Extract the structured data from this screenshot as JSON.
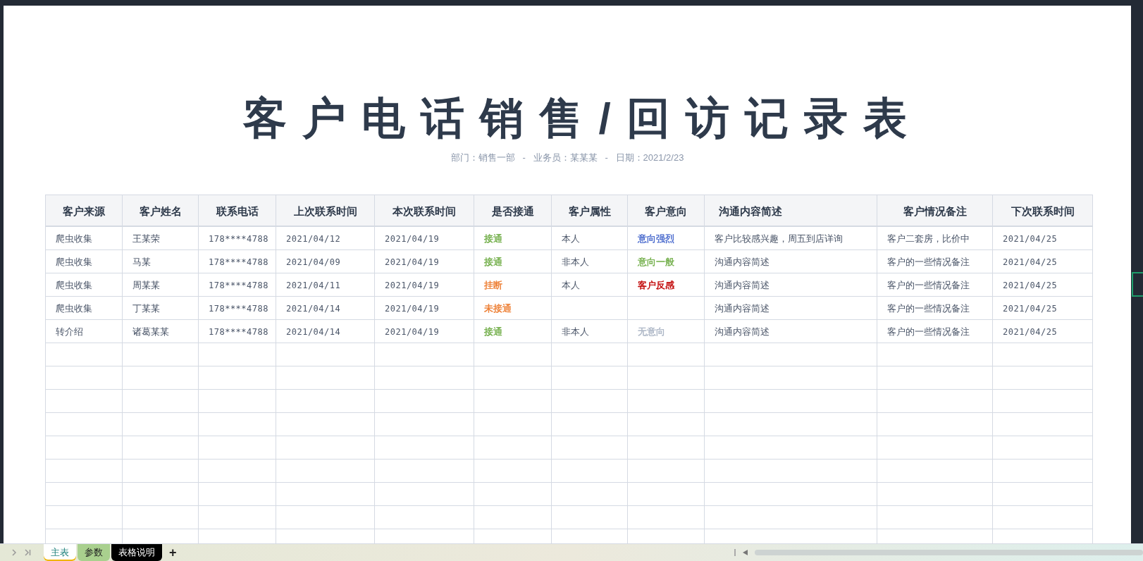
{
  "title": "客户电话销售/回访记录表",
  "subtitle": "部门：销售一部   -   业务员：某某某   -   日期：2021/2/23",
  "table": {
    "columns": [
      "客户来源",
      "客户姓名",
      "联系电话",
      "上次联系时间",
      "本次联系时间",
      "是否接通",
      "客户属性",
      "客户意向",
      "沟通内容简述",
      "客户情况备注",
      "下次联系时间"
    ],
    "rows": [
      {
        "source": "爬虫收集",
        "name": "王某荣",
        "phone": "178****4788",
        "last_contact": "2021/04/12",
        "this_contact": "2021/04/19",
        "connected": {
          "text": "接通",
          "color": "#70ad47"
        },
        "attribute": "本人",
        "intent": {
          "text": "意向强烈",
          "color": "#4466cc"
        },
        "summary": "客户比较感兴趣，周五到店详询",
        "remarks": "客户二套房，比价中",
        "next_contact": "2021/04/25"
      },
      {
        "source": "爬虫收集",
        "name": "马某",
        "phone": "178****4788",
        "last_contact": "2021/04/09",
        "this_contact": "2021/04/19",
        "connected": {
          "text": "接通",
          "color": "#70ad47"
        },
        "attribute": "非本人",
        "intent": {
          "text": "意向一般",
          "color": "#70ad47"
        },
        "summary": "沟通内容简述",
        "remarks": "客户的一些情况备注",
        "next_contact": "2021/04/25"
      },
      {
        "source": "爬虫收集",
        "name": "周某某",
        "phone": "178****4788",
        "last_contact": "2021/04/11",
        "this_contact": "2021/04/19",
        "connected": {
          "text": "挂断",
          "color": "#ed7d31"
        },
        "attribute": "本人",
        "intent": {
          "text": "客户反感",
          "color": "#c00000"
        },
        "summary": "沟通内容简述",
        "remarks": "客户的一些情况备注",
        "next_contact": "2021/04/25"
      },
      {
        "source": "爬虫收集",
        "name": "丁某某",
        "phone": "178****4788",
        "last_contact": "2021/04/14",
        "this_contact": "2021/04/19",
        "connected": {
          "text": "未接通",
          "color": "#ed7d31"
        },
        "summary": "沟通内容简述",
        "remarks": "客户的一些情况备注",
        "next_contact": "2021/04/25"
      },
      {
        "source": "转介绍",
        "name": "诸葛某某",
        "phone": "178****4788",
        "last_contact": "2021/04/14",
        "this_contact": "2021/04/19",
        "connected": {
          "text": "接通",
          "color": "#70ad47"
        },
        "attribute": "非本人",
        "intent": {
          "text": "无意向",
          "color": "#aab4c4"
        },
        "summary": "沟通内容简述",
        "remarks": "客户的一些情况备注",
        "next_contact": "2021/04/25"
      }
    ]
  },
  "sheet_tabs": [
    {
      "label": "主表",
      "selected": true,
      "color": "#ffffff"
    },
    {
      "label": "参数",
      "selected": false,
      "color": "#a9d08e"
    },
    {
      "label": "表格说明",
      "selected": false,
      "color": "#000000"
    }
  ],
  "add_sheet": "+"
}
